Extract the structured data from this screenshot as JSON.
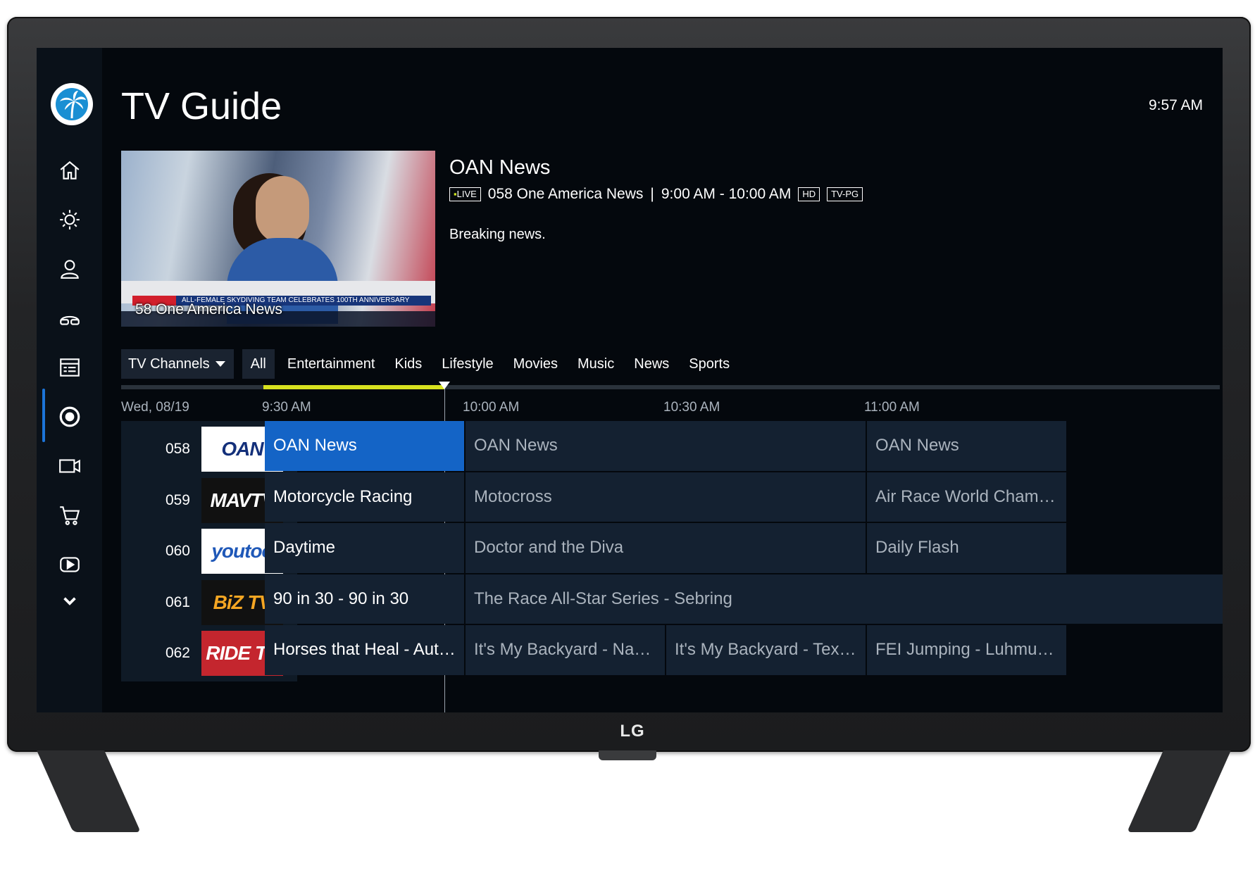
{
  "device": {
    "brand": "LG"
  },
  "app": {
    "title": "TV Guide",
    "clock": "9:57 AM"
  },
  "sidebar": {
    "items": [
      {
        "name": "home",
        "icon": "home-icon"
      },
      {
        "name": "brightness",
        "icon": "sun-icon"
      },
      {
        "name": "profile",
        "icon": "person-icon"
      },
      {
        "name": "vr",
        "icon": "headset-icon"
      },
      {
        "name": "guide",
        "icon": "grid-list-icon",
        "active": true
      },
      {
        "name": "record",
        "icon": "record-icon"
      },
      {
        "name": "video",
        "icon": "camera-icon"
      },
      {
        "name": "shop",
        "icon": "cart-icon"
      },
      {
        "name": "play",
        "icon": "play-icon"
      },
      {
        "name": "more",
        "icon": "chevron-down-icon"
      }
    ]
  },
  "preview": {
    "caption": "58 One America News",
    "ticker": "ALL-FEMALE SKYDIVING TEAM CELEBRATES 100TH ANNIVERSARY"
  },
  "program_info": {
    "title": "OAN News",
    "live_label": "LIVE",
    "channel": "058 One America News",
    "separator": "|",
    "time_range": "9:00 AM - 10:00 AM",
    "quality": "HD",
    "rating": "TV-PG",
    "description": "Breaking news."
  },
  "filters": {
    "dropdown_label": "TV Channels",
    "chips": [
      {
        "label": "All",
        "active": true
      },
      {
        "label": "Entertainment"
      },
      {
        "label": "Kids"
      },
      {
        "label": "Lifestyle"
      },
      {
        "label": "Movies"
      },
      {
        "label": "Music"
      },
      {
        "label": "News"
      },
      {
        "label": "Sports"
      }
    ]
  },
  "timeline": {
    "date": "Wed, 08/19",
    "slots": [
      "9:30 AM",
      "10:00 AM",
      "10:30 AM",
      "11:00 AM"
    ],
    "now_fraction_of_first_slot": 0.9,
    "accent": "#d8e21f"
  },
  "channels": [
    {
      "number": "058",
      "logo": "OAN",
      "logo_bg": "#ffffff",
      "logo_fg": "#14307a",
      "programs": [
        {
          "title": "OAN News",
          "state": "selected"
        },
        {
          "title": "OAN News"
        },
        {
          "title": "OAN News"
        }
      ]
    },
    {
      "number": "059",
      "logo": "MAVTV",
      "logo_bg": "#111111",
      "logo_fg": "#ffffff",
      "programs": [
        {
          "title": "Motorcycle Racing",
          "state": "current"
        },
        {
          "title": "Motocross"
        },
        {
          "title": "Air Race World Champion..."
        }
      ]
    },
    {
      "number": "060",
      "logo": "youtoo",
      "logo_bg": "#ffffff",
      "logo_fg": "#1f58b8",
      "programs": [
        {
          "title": "Daytime",
          "state": "current"
        },
        {
          "title": "Doctor and the Diva"
        },
        {
          "title": "Daily Flash"
        }
      ]
    },
    {
      "number": "061",
      "logo": "BiZ TV",
      "logo_bg": "#111111",
      "logo_fg": "#f5a623",
      "programs": [
        {
          "title": "90 in 30 - 90 in 30",
          "state": "current"
        },
        {
          "title": "The Race All-Star Series - Sebring"
        }
      ]
    },
    {
      "number": "062",
      "logo": "RIDE TV",
      "logo_bg": "#c4262e",
      "logo_fg": "#ffffff",
      "programs": [
        {
          "title": "Horses that Heal - Autum...",
          "state": "current"
        },
        {
          "title": "It's My Backyard - Nashvil..."
        },
        {
          "title": "It's My Backyard - Texas R..."
        },
        {
          "title": "FEI Jumping - Luhmuehle..."
        }
      ]
    }
  ]
}
